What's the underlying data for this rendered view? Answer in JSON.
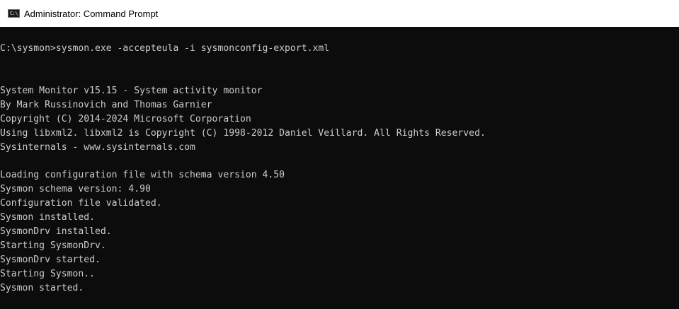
{
  "window": {
    "title": "Administrator: Command Prompt",
    "icon": "cmd-icon",
    "icon_text": "C:\\"
  },
  "console": {
    "background": "#0c0c0c",
    "foreground": "#cccccc",
    "lines": [
      "C:\\sysmon>sysmon.exe -accepteula -i sysmonconfig-export.xml",
      "",
      "",
      "System Monitor v15.15 - System activity monitor",
      "By Mark Russinovich and Thomas Garnier",
      "Copyright (C) 2014-2024 Microsoft Corporation",
      "Using libxml2. libxml2 is Copyright (C) 1998-2012 Daniel Veillard. All Rights Reserved.",
      "Sysinternals - www.sysinternals.com",
      "",
      "Loading configuration file with schema version 4.50",
      "Sysmon schema version: 4.90",
      "Configuration file validated.",
      "Sysmon installed.",
      "SysmonDrv installed.",
      "Starting SysmonDrv.",
      "SysmonDrv started.",
      "Starting Sysmon..",
      "Sysmon started."
    ]
  }
}
